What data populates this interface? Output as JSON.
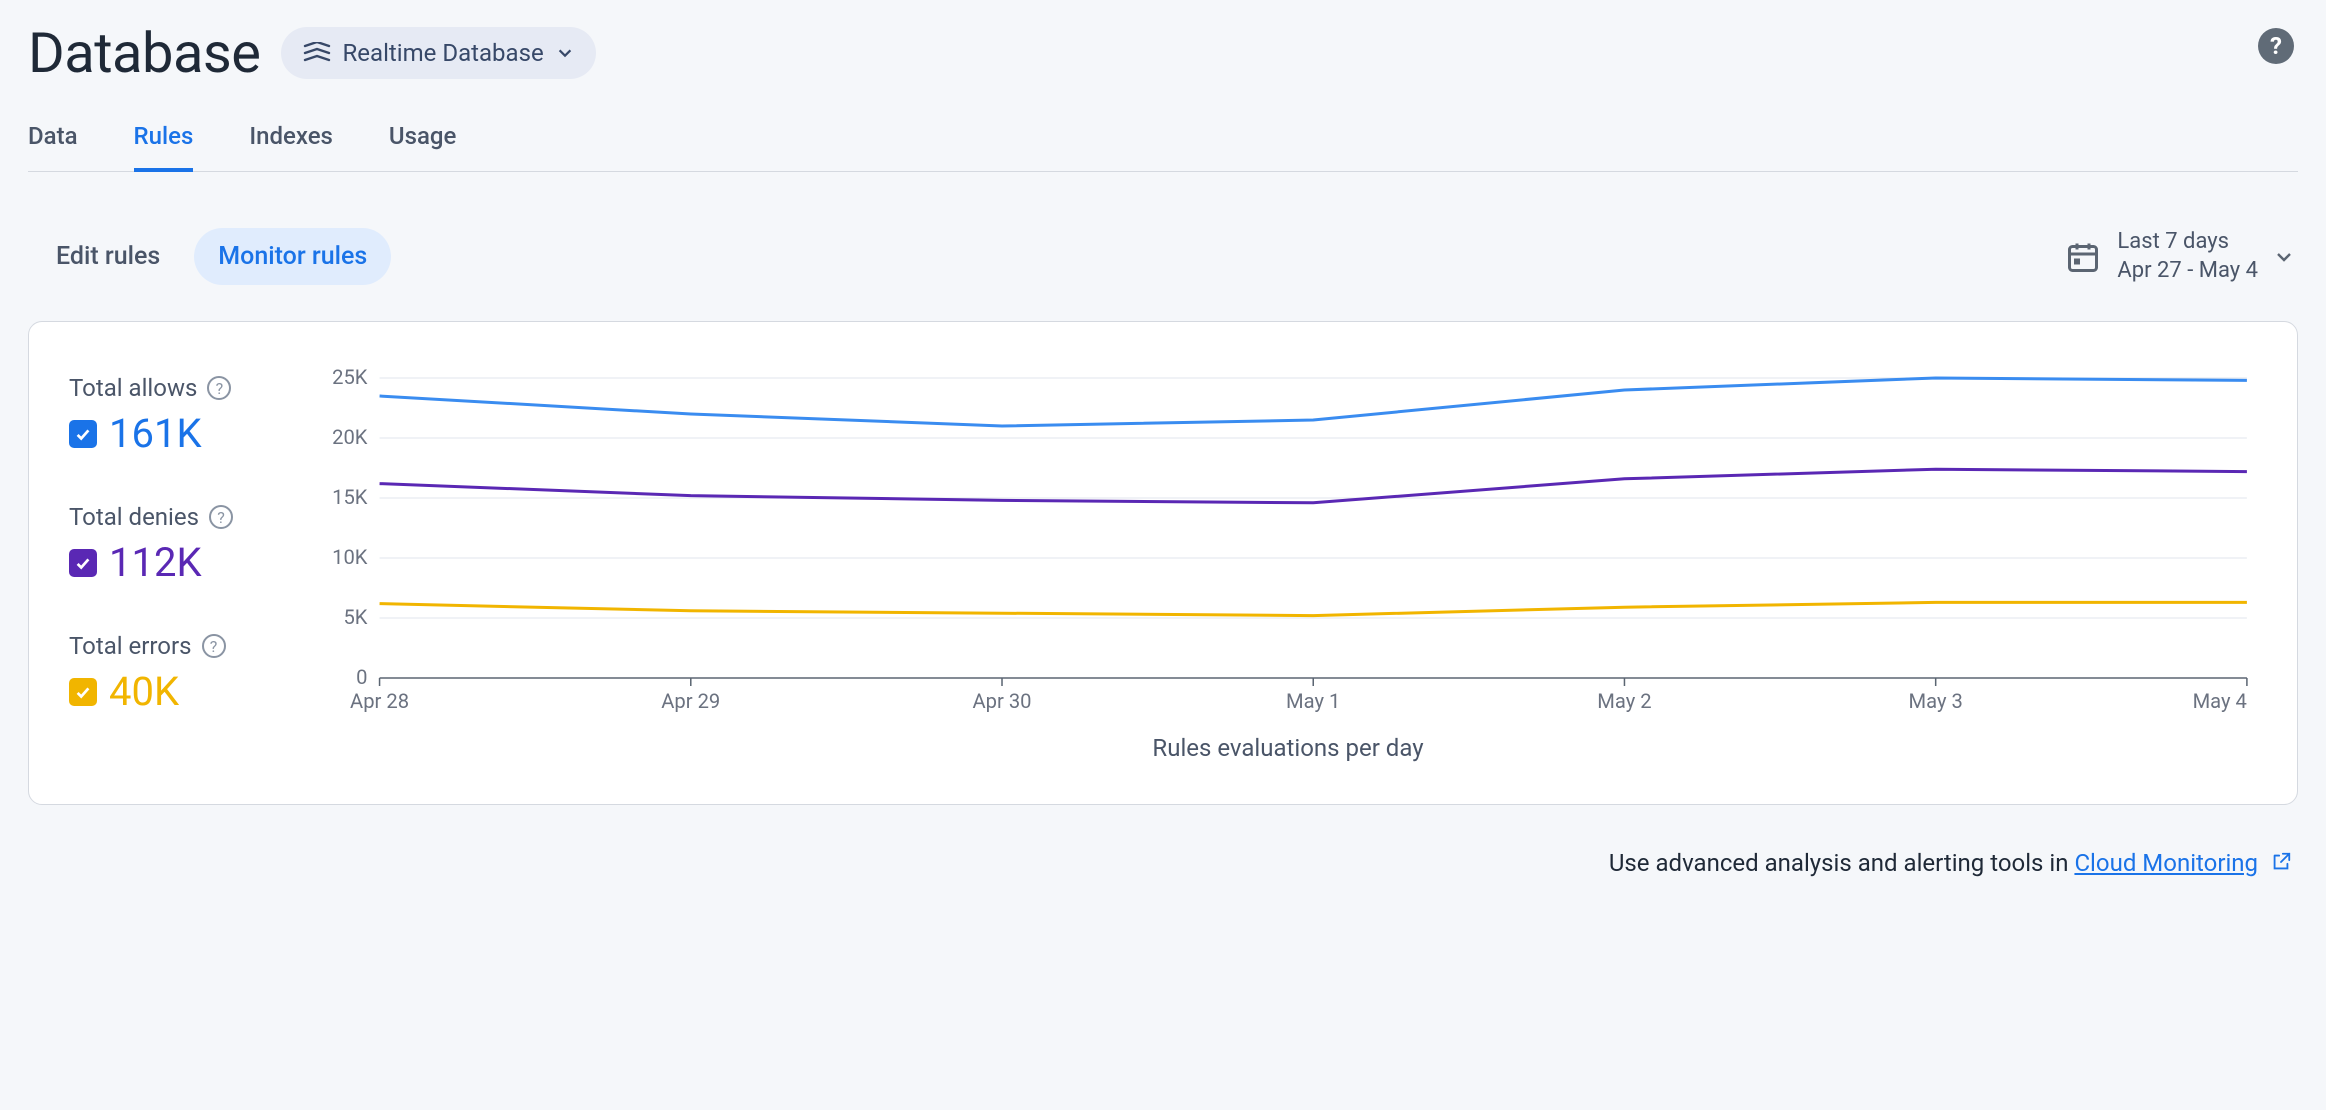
{
  "header": {
    "title": "Database",
    "selector_label": "Realtime Database"
  },
  "tabs": [
    {
      "label": "Data",
      "active": false
    },
    {
      "label": "Rules",
      "active": true
    },
    {
      "label": "Indexes",
      "active": false
    },
    {
      "label": "Usage",
      "active": false
    }
  ],
  "subtabs": [
    {
      "label": "Edit rules",
      "active": false
    },
    {
      "label": "Monitor rules",
      "active": true
    }
  ],
  "date_picker": {
    "range_label": "Last 7 days",
    "range_dates": "Apr 27 - May 4"
  },
  "metrics": {
    "allows": {
      "label": "Total allows",
      "value": "161K",
      "color": "#1a73e8"
    },
    "denies": {
      "label": "Total denies",
      "value": "112K",
      "color": "#5a28b4"
    },
    "errors": {
      "label": "Total errors",
      "value": "40K",
      "color": "#f1b500"
    }
  },
  "footer": {
    "text": "Use advanced analysis and alerting tools in ",
    "link_label": "Cloud Monitoring"
  },
  "chart_data": {
    "type": "line",
    "title": "",
    "xlabel": "Rules evaluations per day",
    "ylabel": "",
    "ylim": [
      0,
      25000
    ],
    "y_ticks": [
      "0",
      "5K",
      "10K",
      "15K",
      "20K",
      "25K"
    ],
    "categories": [
      "Apr 28",
      "Apr 29",
      "Apr 30",
      "May 1",
      "May 2",
      "May 3",
      "May 4"
    ],
    "series": [
      {
        "name": "Total allows",
        "color": "#3a8cf0",
        "values": [
          23500,
          22000,
          21000,
          21500,
          24000,
          25000,
          24800
        ]
      },
      {
        "name": "Total denies",
        "color": "#5a28b4",
        "values": [
          16200,
          15200,
          14800,
          14600,
          16600,
          17400,
          17200
        ]
      },
      {
        "name": "Total errors",
        "color": "#f1b500",
        "values": [
          6200,
          5600,
          5400,
          5200,
          5900,
          6300,
          6300
        ]
      }
    ]
  }
}
